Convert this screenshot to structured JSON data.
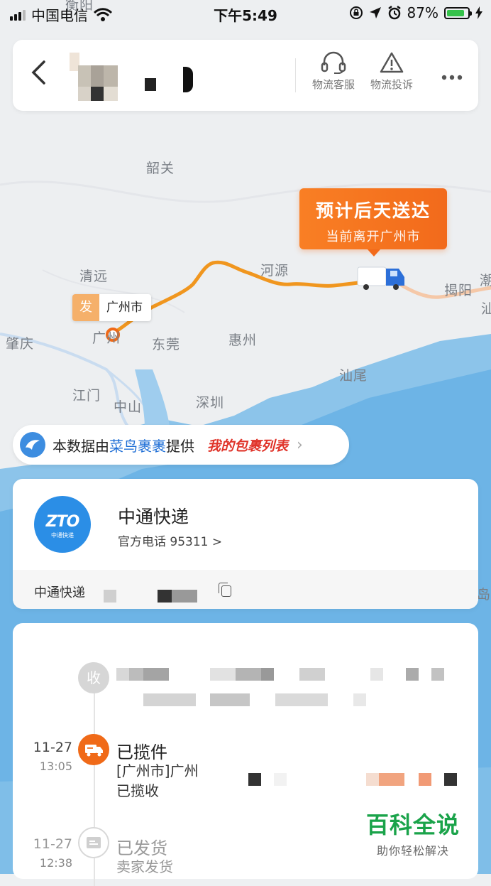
{
  "status_bar": {
    "carrier": "中国电信",
    "time": "下午5:49",
    "battery": "87%",
    "battery_level": 0.87
  },
  "header": {
    "back_icon": "chevron-left-icon",
    "tools": [
      {
        "label": "物流客服",
        "icon": "headset-icon"
      },
      {
        "label": "物流投诉",
        "icon": "warning-icon"
      }
    ],
    "more_icon": "more-icon"
  },
  "map": {
    "cities": [
      "衡阳",
      "韶关",
      "清远",
      "河源",
      "揭阳",
      "肇庆",
      "东莞",
      "惠州",
      "汕尾",
      "江门",
      "中山",
      "深圳",
      "潮",
      "汕",
      "岛"
    ],
    "guangzhou_label": "广州",
    "eta_title": "预计后天送达",
    "eta_subtitle": "当前离开广州市",
    "origin_badge": "发",
    "origin_city": "广州市",
    "route_color": "#f0961f",
    "remaining_route_color": "#f5c8a8"
  },
  "source": {
    "prefix": "本数据由",
    "brand": "菜鸟裹裹",
    "suffix": "提供",
    "my_list": "我的包裹列表"
  },
  "courier": {
    "logo_text": "ZTO",
    "logo_sub": "中通快递",
    "name": "中通快递",
    "phone": "官方电话 95311 >",
    "waybill_label": "中通快递"
  },
  "timeline": [
    {
      "icon": "receive-icon",
      "badge": "收",
      "date": "",
      "time": "",
      "title": "",
      "desc": ""
    },
    {
      "icon": "truck-icon",
      "badge": "",
      "date": "11-27",
      "time": "13:05",
      "title": "已揽件",
      "desc": "[广州市]广州",
      "desc2": "已揽收"
    },
    {
      "icon": "box-icon",
      "badge": "",
      "date": "11-27",
      "time": "12:38",
      "title": "已发货",
      "desc": "卖家发货",
      "desc2": ""
    }
  ],
  "watermark": {
    "title": "百科全说",
    "subtitle": "助你轻松解决"
  }
}
